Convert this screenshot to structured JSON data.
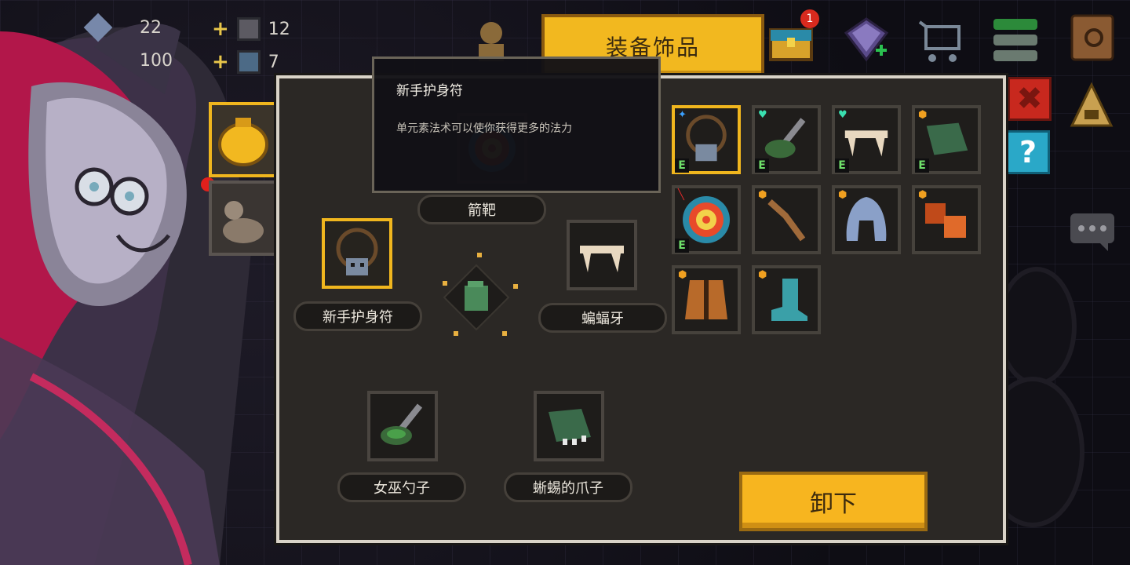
{
  "resources": [
    {
      "icon": "gem-icon",
      "value": "22"
    },
    {
      "icon": "coin-icon",
      "value": "100"
    },
    {
      "icon": "potion-red-icon",
      "value": "12"
    },
    {
      "icon": "potion-blue-icon",
      "value": "7"
    }
  ],
  "header": {
    "title": "装备饰品"
  },
  "top_icons": [
    {
      "name": "character-avatar-icon"
    },
    {
      "name": "treasure-chest-icon",
      "badge": "1"
    },
    {
      "name": "diamond-shop-icon"
    },
    {
      "name": "cart-icon"
    },
    {
      "name": "menu-list-icon"
    },
    {
      "name": "leather-book-icon"
    }
  ],
  "tooltip": {
    "title": "新手护身符",
    "description": "单元素法术可以使你获得更多的法力"
  },
  "equipped": {
    "top": {
      "label": "箭靶",
      "icon": "target-icon"
    },
    "left": {
      "label": "新手护身符",
      "icon": "amulet-icon"
    },
    "right": {
      "label": "蝙蝠牙",
      "icon": "bat-fang-icon"
    },
    "bottom_left": {
      "label": "女巫勺子",
      "icon": "witch-spoon-icon"
    },
    "bottom_right": {
      "label": "蜥蜴的爪子",
      "icon": "lizard-claw-icon"
    },
    "center": {
      "icon": "glove-center-icon"
    }
  },
  "inventory": [
    {
      "icon": "amulet-icon",
      "badge": "E",
      "mark": "star",
      "selected": true
    },
    {
      "icon": "witch-spoon-icon",
      "badge": "E",
      "mark": "heart"
    },
    {
      "icon": "bat-fang-icon",
      "badge": "E",
      "mark": "heart"
    },
    {
      "icon": "lizard-claw-icon",
      "badge": "E",
      "mark": "shield"
    },
    {
      "icon": "target-icon",
      "badge": "E",
      "mark": "pin"
    },
    {
      "icon": "wooden-boomerang-icon",
      "badge": "",
      "mark": "shield"
    },
    {
      "icon": "hood-icon",
      "badge": "",
      "mark": "shield"
    },
    {
      "icon": "lava-chunks-icon",
      "badge": "",
      "mark": "shield"
    },
    {
      "icon": "leather-vest-icon",
      "badge": "",
      "mark": "shield"
    },
    {
      "icon": "teal-boot-icon",
      "badge": "",
      "mark": "shield"
    }
  ],
  "buttons": {
    "unequip": "卸下",
    "close": "✖",
    "help": "?"
  },
  "colors": {
    "accent": "#f7b51f",
    "panel": "#2b2825",
    "border": "#d9d3c8",
    "equip_badge": "#6fe06a"
  }
}
